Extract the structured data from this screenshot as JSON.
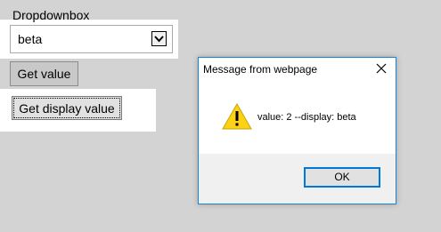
{
  "page": {
    "dropdown_label": "Dropdownbox",
    "dropdown_selected": "beta",
    "get_value_button": "Get value",
    "get_display_value_button": "Get display value"
  },
  "dialog": {
    "title": "Message from webpage",
    "message": "value: 2 --display: beta",
    "ok_button": "OK",
    "icon": "warning-icon",
    "close_icon": "close-icon"
  },
  "colors": {
    "page_background": "#d3d3d3",
    "dialog_border": "#1883d7",
    "ok_button_border": "#0078d7",
    "warning_fill": "#fcd116"
  }
}
